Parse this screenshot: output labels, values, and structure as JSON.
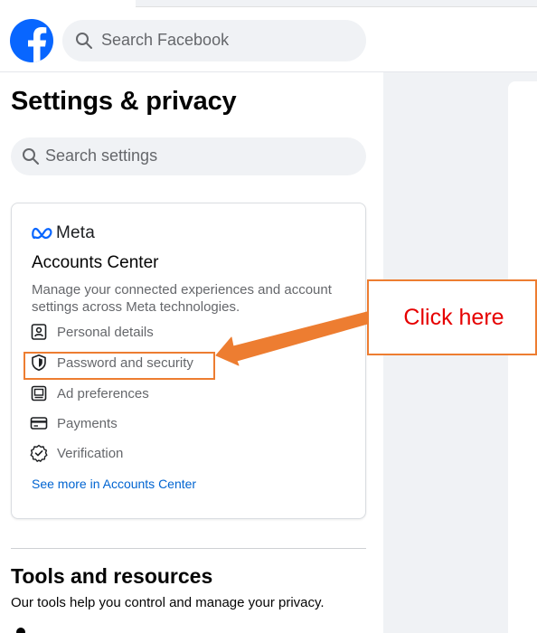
{
  "header": {
    "search_placeholder": "Search Facebook",
    "logo_icon": "facebook-logo",
    "brand_color": "#0866ff"
  },
  "sidebar": {
    "title": "Settings & privacy",
    "search_placeholder": "Search settings",
    "accounts_center": {
      "brand": "Meta",
      "title": "Accounts Center",
      "description": "Manage your connected experiences and account settings across Meta technologies.",
      "items": [
        {
          "label": "Personal details",
          "icon": "id-card-icon"
        },
        {
          "label": "Password and security",
          "icon": "shield-icon"
        },
        {
          "label": "Ad preferences",
          "icon": "monitor-icon"
        },
        {
          "label": "Payments",
          "icon": "credit-card-icon"
        },
        {
          "label": "Verification",
          "icon": "check-badge-icon"
        }
      ],
      "see_more": "See more in Accounts Center"
    },
    "tools": {
      "title": "Tools and resources",
      "description": "Our tools help you control and manage your privacy."
    }
  },
  "annotation": {
    "callout_text": "Click here",
    "accent_color": "#ed7d31",
    "text_color": "#e60000"
  }
}
